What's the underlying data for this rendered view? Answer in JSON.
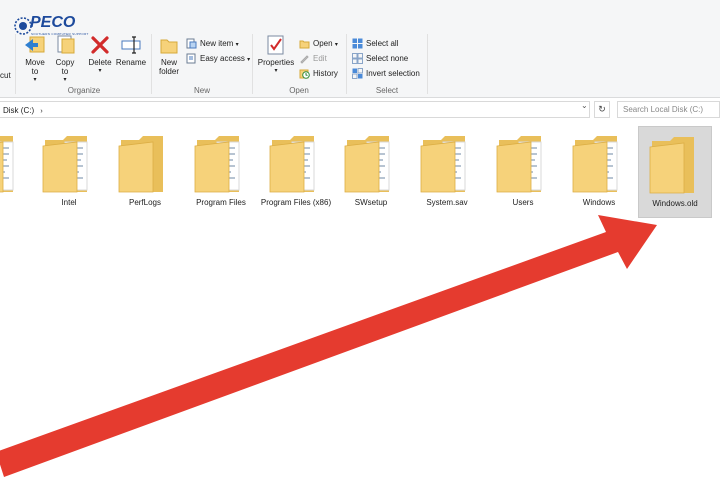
{
  "logo": {
    "text": "PECO",
    "subtext": "SOUTHERN COMPUTER SUPPORT"
  },
  "ribbon": {
    "clipboard_partial": "cut",
    "organize": {
      "label": "Organize",
      "move_to": "Move to",
      "copy_to": "Copy to",
      "delete": "Delete",
      "rename": "Rename"
    },
    "new": {
      "label": "New",
      "new_folder": "New folder",
      "new_item": "New item",
      "easy_access": "Easy access"
    },
    "open": {
      "label": "Open",
      "properties": "Properties",
      "open": "Open",
      "edit": "Edit",
      "history": "History"
    },
    "select": {
      "label": "Select",
      "select_all": "Select all",
      "select_none": "Select none",
      "invert_selection": "Invert selection"
    }
  },
  "address": {
    "path": "Disk (C:)",
    "search_placeholder": "Search Local Disk (C:)"
  },
  "folders": [
    {
      "name": ""
    },
    {
      "name": "Intel"
    },
    {
      "name": "PerfLogs"
    },
    {
      "name": "Program Files"
    },
    {
      "name": "Program Files (x86)"
    },
    {
      "name": "SWsetup"
    },
    {
      "name": "System.sav"
    },
    {
      "name": "Users"
    },
    {
      "name": "Windows"
    },
    {
      "name": "Windows.old"
    }
  ],
  "selected_folder": "Windows.old",
  "colors": {
    "arrow": "#e53b2f",
    "folder": "#f6d27a",
    "selection": "#d9d9d9",
    "logo": "#1d4a9c"
  }
}
